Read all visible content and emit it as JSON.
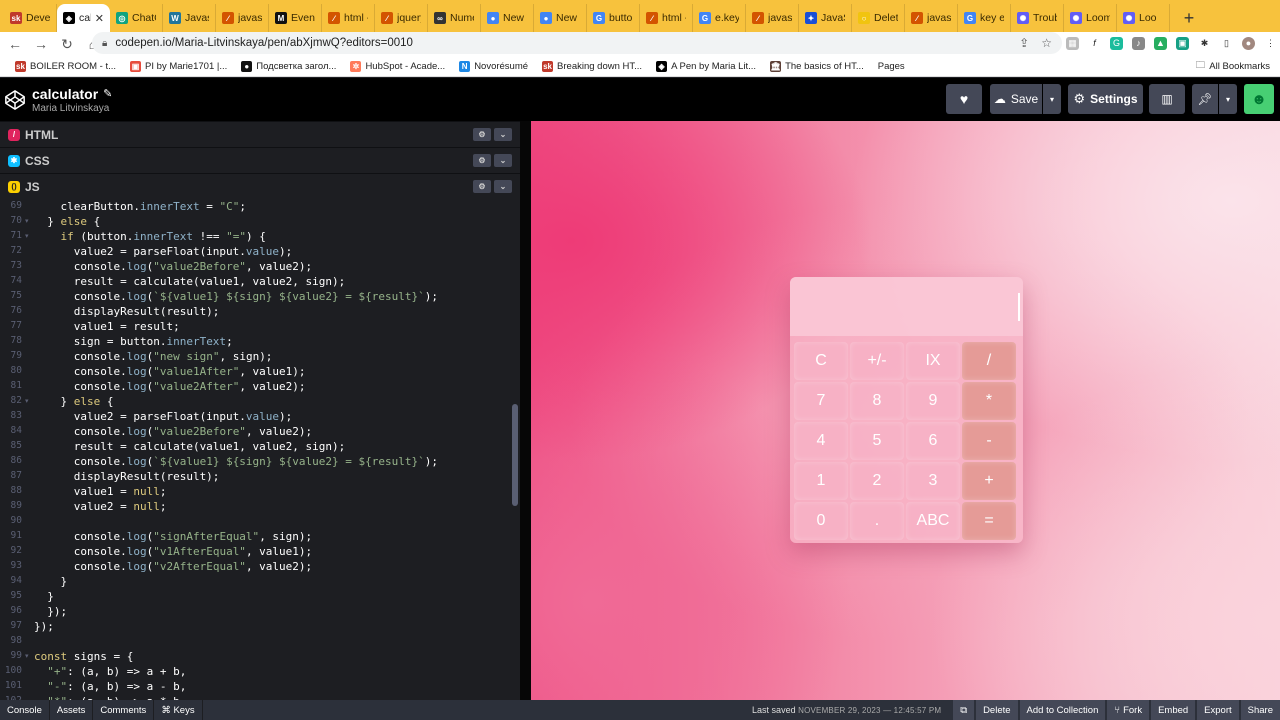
{
  "browser": {
    "tabs": [
      {
        "title": "Develo",
        "icon": "sk-icon",
        "color": "#c0392b",
        "glyph": "sk"
      },
      {
        "title": "calc",
        "icon": "codepen-icon",
        "color": "#000000",
        "glyph": "◈",
        "active": true
      },
      {
        "title": "ChatGF",
        "icon": "chatgpt-icon",
        "color": "#10a37f",
        "glyph": "◎"
      },
      {
        "title": "Javasc",
        "icon": "wordpress-icon",
        "color": "#21759b",
        "glyph": "W"
      },
      {
        "title": "javascr",
        "icon": "mdn-icon",
        "color": "#d35400",
        "glyph": "∕"
      },
      {
        "title": "Event:",
        "icon": "mdn-m-icon",
        "color": "#111111",
        "glyph": "M"
      },
      {
        "title": "html -",
        "icon": "mdn-icon",
        "color": "#d35400",
        "glyph": "∕"
      },
      {
        "title": "jquery",
        "icon": "mdn-icon",
        "color": "#d35400",
        "glyph": "∕"
      },
      {
        "title": "Numer",
        "icon": "infinity-icon",
        "color": "#333333",
        "glyph": "∞"
      },
      {
        "title": "New Ta",
        "icon": "chrome-icon",
        "color": "#4285f4",
        "glyph": "●"
      },
      {
        "title": "New Ta",
        "icon": "chrome-icon",
        "color": "#4285f4",
        "glyph": "●"
      },
      {
        "title": "button",
        "icon": "google-icon",
        "color": "#4285f4",
        "glyph": "G"
      },
      {
        "title": "html -",
        "icon": "mdn-icon",
        "color": "#d35400",
        "glyph": "∕"
      },
      {
        "title": "e.key =",
        "icon": "google-icon",
        "color": "#4285f4",
        "glyph": "G"
      },
      {
        "title": "javascr",
        "icon": "mdn-icon",
        "color": "#d35400",
        "glyph": "∕"
      },
      {
        "title": "JavaSc",
        "icon": "bookmark-icon",
        "color": "#1a4fd6",
        "glyph": "✦"
      },
      {
        "title": "Delete",
        "icon": "circle-icon",
        "color": "#f1c40f",
        "glyph": "○"
      },
      {
        "title": "javascr",
        "icon": "mdn-icon",
        "color": "#d35400",
        "glyph": "∕"
      },
      {
        "title": "key eve",
        "icon": "google-icon",
        "color": "#4285f4",
        "glyph": "G"
      },
      {
        "title": "Trouble",
        "icon": "loom-icon",
        "color": "#625df5",
        "glyph": "✺"
      },
      {
        "title": "Loom",
        "icon": "loom-icon",
        "color": "#625df5",
        "glyph": "✺"
      },
      {
        "title": "Loo",
        "icon": "loom-icon",
        "color": "#625df5",
        "glyph": "✺"
      }
    ],
    "new_tab": "+",
    "url": "codepen.io/Maria-Litvinskaya/pen/abXjmwQ?editors=0010",
    "bookmarks": [
      {
        "label": "BOILER ROOM - t...",
        "icon": "sk-icon",
        "color": "#c0392b",
        "glyph": "sk"
      },
      {
        "label": "PI by Marie1701 |...",
        "icon": "image-icon",
        "color": "#e74c3c",
        "glyph": "▣"
      },
      {
        "label": "Подсветка загол...",
        "icon": "github-icon",
        "color": "#111111",
        "glyph": "●"
      },
      {
        "label": "HubSpot - Acade...",
        "icon": "hubspot-icon",
        "color": "#ff7a59",
        "glyph": "✲"
      },
      {
        "label": "Novorésumé",
        "icon": "novoresume-icon",
        "color": "#1e88e5",
        "glyph": "N"
      },
      {
        "label": "Breaking down HT...",
        "icon": "sk-icon",
        "color": "#c0392b",
        "glyph": "sk"
      },
      {
        "label": "A Pen by Maria Lit...",
        "icon": "codepen-icon",
        "color": "#000000",
        "glyph": "◈"
      },
      {
        "label": "The basics of HT...",
        "icon": "museum-icon",
        "color": "#5d4037",
        "glyph": "🏛"
      },
      {
        "label": "Pages",
        "icon": "",
        "color": "#ffffff",
        "glyph": ""
      }
    ],
    "all_bookmarks": "All Bookmarks"
  },
  "codepen": {
    "pen_title": "calculator",
    "author": "Maria Litvinskaya",
    "save_label": "Save",
    "settings_label": "Settings",
    "panes": {
      "html": "HTML",
      "css": "CSS",
      "js": "JS"
    }
  },
  "code_lines": [
    {
      "n": "69",
      "text": "    clearButton.innerText = \"C\";"
    },
    {
      "n": "70",
      "text": "  } else {",
      "fold": true
    },
    {
      "n": "71",
      "text": "    if (button.innerText !== \"=\") {",
      "fold": true
    },
    {
      "n": "72",
      "text": "      value2 = parseFloat(input.value);"
    },
    {
      "n": "73",
      "text": "      console.log(\"value2Before\", value2);"
    },
    {
      "n": "74",
      "text": "      result = calculate(value1, value2, sign);"
    },
    {
      "n": "75",
      "text": "      console.log(`${value1} ${sign} ${value2} = ${result}`);"
    },
    {
      "n": "76",
      "text": "      displayResult(result);"
    },
    {
      "n": "77",
      "text": "      value1 = result;"
    },
    {
      "n": "78",
      "text": "      sign = button.innerText;"
    },
    {
      "n": "79",
      "text": "      console.log(\"new sign\", sign);"
    },
    {
      "n": "80",
      "text": "      console.log(\"value1After\", value1);"
    },
    {
      "n": "81",
      "text": "      console.log(\"value2After\", value2);"
    },
    {
      "n": "82",
      "text": "    } else {",
      "fold": true
    },
    {
      "n": "83",
      "text": "      value2 = parseFloat(input.value);"
    },
    {
      "n": "84",
      "text": "      console.log(\"value2Before\", value2);"
    },
    {
      "n": "85",
      "text": "      result = calculate(value1, value2, sign);"
    },
    {
      "n": "86",
      "text": "      console.log(`${value1} ${sign} ${value2} = ${result}`);"
    },
    {
      "n": "87",
      "text": "      displayResult(result);"
    },
    {
      "n": "88",
      "text": "      value1 = null;"
    },
    {
      "n": "89",
      "text": "      value2 = null;"
    },
    {
      "n": "90",
      "text": ""
    },
    {
      "n": "91",
      "text": "      console.log(\"signAfterEqual\", sign);"
    },
    {
      "n": "92",
      "text": "      console.log(\"v1AfterEqual\", value1);"
    },
    {
      "n": "93",
      "text": "      console.log(\"v2AfterEqual\", value2);"
    },
    {
      "n": "94",
      "text": "    }"
    },
    {
      "n": "95",
      "text": "  }"
    },
    {
      "n": "96",
      "text": "  });"
    },
    {
      "n": "97",
      "text": "});"
    },
    {
      "n": "98",
      "text": ""
    },
    {
      "n": "99",
      "text": "const signs = {",
      "fold": true
    },
    {
      "n": "100",
      "text": "  \"+\": (a, b) => a + b,"
    },
    {
      "n": "101",
      "text": "  \"-\": (a, b) => a - b,"
    },
    {
      "n": "102",
      "text": "  \"*\": (a, b) => a * b,"
    }
  ],
  "calculator": {
    "display_value": "",
    "keys": [
      [
        "C",
        "+/-",
        "IX",
        "/"
      ],
      [
        "7",
        "8",
        "9",
        "*"
      ],
      [
        "4",
        "5",
        "6",
        "-"
      ],
      [
        "1",
        "2",
        "3",
        "+"
      ],
      [
        "0",
        ".",
        "ABC",
        "="
      ]
    ]
  },
  "status": {
    "console": "Console",
    "assets": "Assets",
    "comments": "Comments",
    "keys": "⌘ Keys",
    "last_saved_label": "Last saved",
    "last_saved_date": "NOVEMBER 29, 2023 — 12:45:57 PM",
    "delete": "Delete",
    "add_to_collection": "Add to Collection",
    "fork": "Fork",
    "embed": "Embed",
    "export": "Export",
    "share": "Share"
  },
  "colors": {
    "codepen_header": "#000000",
    "editor_bg": "#1d1e22",
    "button_bg": "#444857",
    "operator_key": "#e59b97",
    "html_badge": "#e0245e",
    "css_badge": "#0ebeff",
    "js_badge": "#fcd000"
  }
}
